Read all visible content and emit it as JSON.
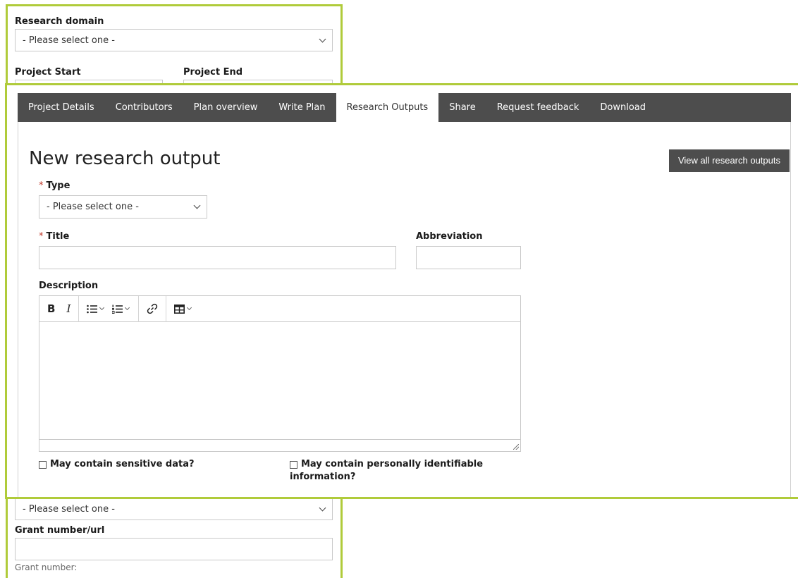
{
  "background_form": {
    "research_domain_label": "Research domain",
    "research_domain_value": "- Please select one -",
    "project_start_label": "Project Start",
    "project_end_label": "Project End",
    "funder_select_value": "- Please select one -",
    "grant_label": "Grant number/url",
    "grant_help": "Grant number:"
  },
  "tabs": [
    {
      "label": "Project Details",
      "active": false
    },
    {
      "label": "Contributors",
      "active": false
    },
    {
      "label": "Plan overview",
      "active": false
    },
    {
      "label": "Write Plan",
      "active": false
    },
    {
      "label": "Research Outputs",
      "active": true
    },
    {
      "label": "Share",
      "active": false
    },
    {
      "label": "Request feedback",
      "active": false
    },
    {
      "label": "Download",
      "active": false
    }
  ],
  "page": {
    "title": "New research output",
    "view_all_button": "View all research outputs"
  },
  "form": {
    "required_marker": "*",
    "type_label": "Type",
    "type_value": "- Please select one -",
    "title_label": "Title",
    "title_value": "",
    "abbreviation_label": "Abbreviation",
    "abbreviation_value": "",
    "description_label": "Description",
    "sensitive_label": "May contain sensitive data?",
    "pii_label_line1": "May contain personally identifiable",
    "pii_label_line2": "information?"
  },
  "editor_toolbar": {
    "bold": "B",
    "italic": "I",
    "bullet_list": "☰",
    "numbered_list": "☰",
    "link": "🔗",
    "table": "⊞"
  },
  "colors": {
    "frame_border": "#b0cb3a",
    "tab_bar": "#4d4d4d",
    "required": "#c0392b"
  }
}
